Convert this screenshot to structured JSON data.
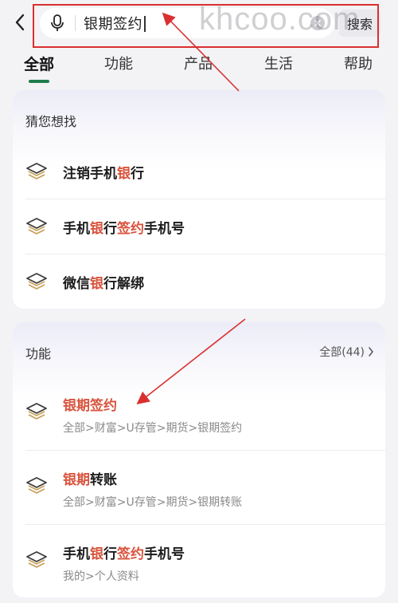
{
  "search": {
    "query": "银期签约",
    "button_label": "搜索"
  },
  "watermark": "khcoo.com",
  "tabs": [
    {
      "label": "全部",
      "active": true
    },
    {
      "label": "功能",
      "active": false
    },
    {
      "label": "产品",
      "active": false
    },
    {
      "label": "生活",
      "active": false
    },
    {
      "label": "帮助",
      "active": false
    }
  ],
  "guess": {
    "title": "猜您想找",
    "items": [
      {
        "parts": [
          {
            "t": "注销手机",
            "h": false
          },
          {
            "t": "银",
            "h": true
          },
          {
            "t": "行",
            "h": false
          }
        ]
      },
      {
        "parts": [
          {
            "t": "手机",
            "h": false
          },
          {
            "t": "银",
            "h": true
          },
          {
            "t": "行",
            "h": false
          },
          {
            "t": "签约",
            "h": true
          },
          {
            "t": "手机号",
            "h": false
          }
        ]
      },
      {
        "parts": [
          {
            "t": "微信",
            "h": false
          },
          {
            "t": "银",
            "h": true
          },
          {
            "t": "行解绑",
            "h": false
          }
        ]
      }
    ]
  },
  "functions": {
    "title": "功能",
    "more_label": "全部(44)",
    "items": [
      {
        "parts": [
          {
            "t": "银期签约",
            "h": true
          }
        ],
        "path": "全部>财富>U存管>期货>银期签约"
      },
      {
        "parts": [
          {
            "t": "银期",
            "h": true
          },
          {
            "t": "转账",
            "h": false
          }
        ],
        "path": "全部>财富>U存管>期货>银期转账"
      },
      {
        "parts": [
          {
            "t": "手机",
            "h": false
          },
          {
            "t": "银",
            "h": true
          },
          {
            "t": "行",
            "h": false
          },
          {
            "t": "签约",
            "h": true
          },
          {
            "t": "手机号",
            "h": false
          }
        ],
        "path": "我的>个人资料"
      }
    ]
  },
  "colors": {
    "highlight": "#d9543e",
    "tab_indicator": "#1f7d4b",
    "annotation": "#d9302f"
  },
  "icons": [
    "chevron-left-icon",
    "mic-icon",
    "clear-icon",
    "layers-icon",
    "chevron-right-icon"
  ]
}
